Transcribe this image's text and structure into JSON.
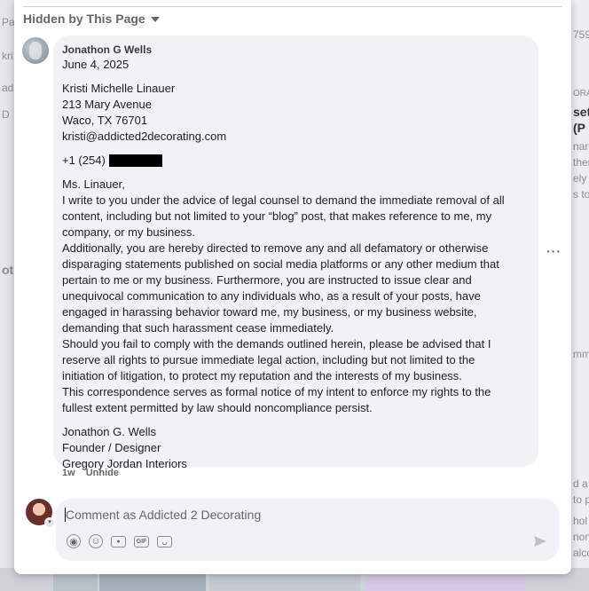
{
  "background": {
    "left_fragments": [
      "Pa",
      "kri",
      "ad",
      "D",
      "ot"
    ],
    "right_fragments": [
      "759",
      "ORA",
      "set",
      "(P",
      "nare",
      "ther",
      "ely",
      "s to",
      "mm",
      "d a",
      "to p",
      "hol",
      "non",
      "alco"
    ]
  },
  "section": {
    "header": "Hidden by This Page"
  },
  "comment": {
    "author": "Jonathon G Wells",
    "date": "June 4, 2025",
    "recipient": [
      "Kristi Michelle Linauer",
      "213 Mary Avenue",
      "Waco, TX 76701",
      "kristi@addicted2decorating.com"
    ],
    "phone_prefix": "+1 (254)",
    "salutation": "Ms. Linauer,",
    "body_lines": [
      "I write to you under the advice of legal counsel to demand the immediate removal of all",
      "content, including but not limited to your “blog” post, that makes reference to me, my",
      "company, or my business.",
      "Additionally, you are hereby directed to remove any and all defamatory or otherwise",
      "disparaging statements published on social media platforms or any other medium that",
      "pertain to me or my business. Furthermore, you are instructed to issue clear and",
      "unequivocal communication to any individuals who, as a result of your posts, have",
      "engaged in harassing behavior toward me, my business, or my business website,",
      "demanding that such harassment cease immediately.",
      "Should you fail to comply with the demands outlined herein, please be advised that I",
      "reserve all rights to pursue immediate legal action, including but not limited to the",
      "initiation of litigation, to protect my reputation and the interests of my business.",
      "This correspondence serves as formal notice of my intent to enforce my rights to the",
      "fullest extent permitted by law should noncompliance persist."
    ],
    "signature": [
      "Jonathon G. Wells",
      "Founder / Designer",
      "Gregory Jordan Interiors"
    ],
    "time_ago": "1w",
    "unhide_label": "Unhide",
    "more_label": "···"
  },
  "composer": {
    "placeholder": "Comment as Addicted 2 Decorating",
    "icons": [
      "avatar-sticker-icon",
      "emoji-icon",
      "camera-icon",
      "gif-icon",
      "sticker-icon",
      "send-icon"
    ]
  }
}
